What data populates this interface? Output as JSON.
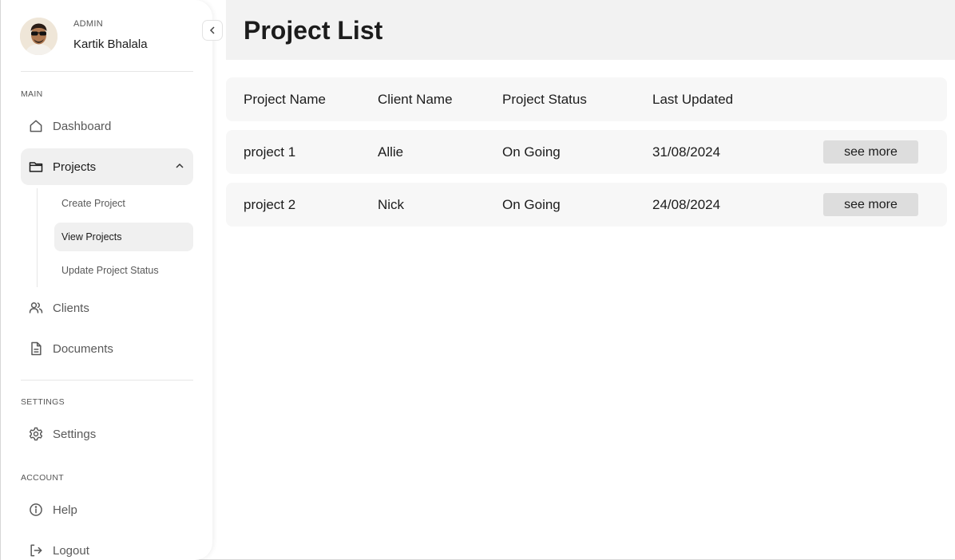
{
  "profile": {
    "role": "ADMIN",
    "name": "Kartik Bhalala"
  },
  "sidebar": {
    "sections": {
      "main": "MAIN",
      "settings": "SETTINGS",
      "account": "ACCOUNT"
    },
    "items": {
      "dashboard": {
        "label": "Dashboard",
        "icon": "home-icon"
      },
      "projects": {
        "label": "Projects",
        "icon": "folder-icon",
        "expanded": true
      },
      "clients": {
        "label": "Clients",
        "icon": "users-icon"
      },
      "documents": {
        "label": "Documents",
        "icon": "document-icon"
      },
      "settings": {
        "label": "Settings",
        "icon": "gear-icon"
      },
      "help": {
        "label": "Help",
        "icon": "info-icon"
      },
      "logout": {
        "label": "Logout",
        "icon": "logout-icon"
      }
    },
    "project_submenu": [
      {
        "label": "Create Project"
      },
      {
        "label": "View Projects",
        "active": true
      },
      {
        "label": "Update Project Status"
      }
    ]
  },
  "main": {
    "title": "Project List",
    "table": {
      "headers": [
        "Project Name",
        "Client Name",
        "Project Status",
        "Last Updated"
      ],
      "rows": [
        [
          "project 1",
          "Allie",
          "On Going",
          "31/08/2024"
        ],
        [
          "project 2",
          "Nick",
          "On Going",
          "24/08/2024"
        ]
      ],
      "action_label": "see more"
    }
  }
}
